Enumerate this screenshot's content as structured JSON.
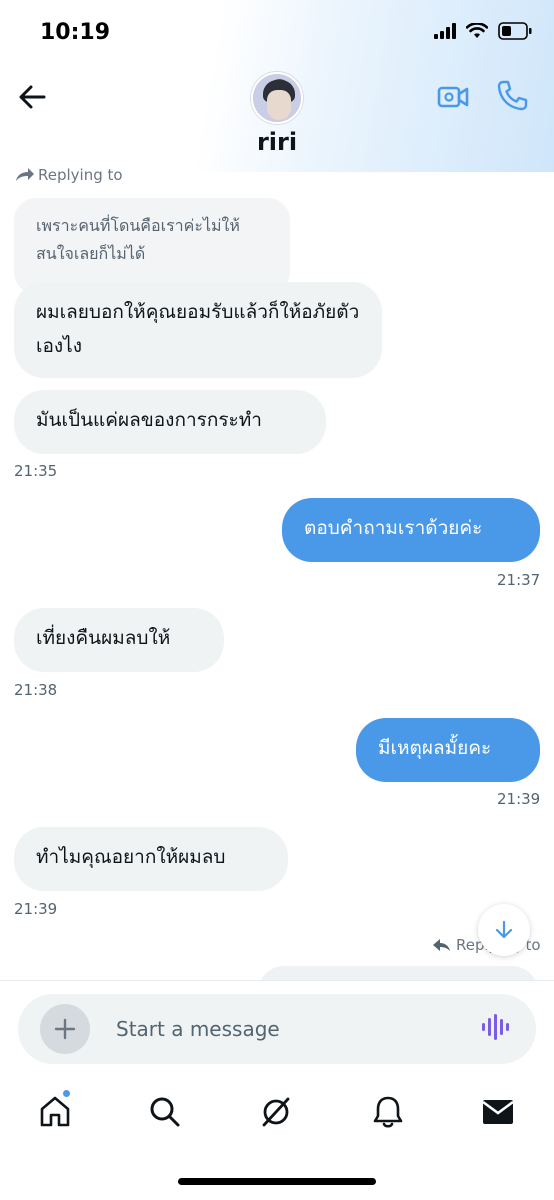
{
  "status_bar": {
    "time": "10:19"
  },
  "header": {
    "contact_name": "riri",
    "icons": [
      "back-arrow-icon",
      "video-call-icon",
      "phone-call-icon"
    ]
  },
  "messages": {
    "reply_label_1": "Replying to",
    "quoted_text": "เพราะคนที่โดนคือเราค่ะไม่ให้สนใจเลยก็ไม่ได้",
    "msg_1": "ผมเลยบอกให้คุณยอมรับแล้วก็ให้อภัยตัวเองไง",
    "msg_2": "มันเป็นแค่ผลของการกระทำ",
    "time_1": "21:35",
    "msg_3": "ตอบคำถามเราด้วยค่ะ",
    "time_2": "21:37",
    "msg_4": "เที่ยงคืนผมลบให้",
    "time_3": "21:38",
    "msg_5": "มีเหตุผลมั้ยคะ",
    "time_4": "21:39",
    "msg_6": "ทำไมคุณอยากให้ผมลบ",
    "time_5": "21:39",
    "reply_label_2": "Replying to"
  },
  "composer": {
    "placeholder": "Start a message"
  },
  "tabbar": {
    "items": [
      "home-icon",
      "search-icon",
      "grok-icon",
      "notifications-icon",
      "messages-icon"
    ]
  },
  "colors": {
    "outgoing": "#4a99e9",
    "incoming": "#eff3f4",
    "accent": "#4a99e9",
    "voice": "#7b5ce6"
  }
}
